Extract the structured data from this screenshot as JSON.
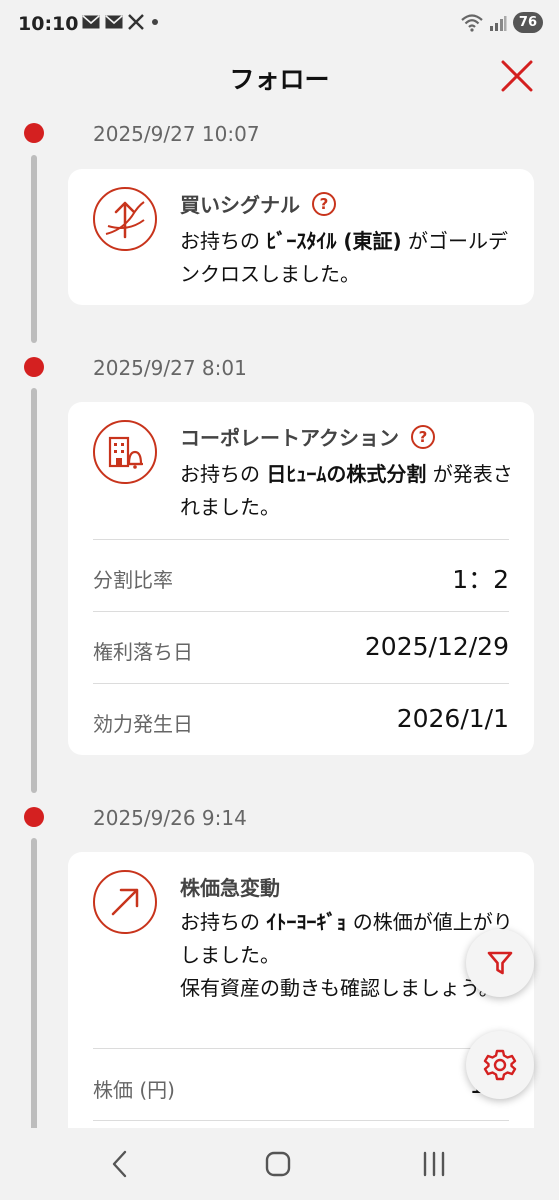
{
  "status_bar": {
    "time": "10:10",
    "battery": "76"
  },
  "header": {
    "title": "フォロー"
  },
  "colors": {
    "accent": "#d42020",
    "icon_stroke": "#c8341c",
    "background": "#f2f2f2"
  },
  "timeline": [
    {
      "date": "2025/9/27 10:07",
      "type": "買いシグナル",
      "icon": "golden-cross-icon",
      "msg_pre": "お持ちの ",
      "msg_bold": "ﾋﾞｰｽﾀｲﾙ (東証)",
      "msg_post": " がゴールデンクロスしました。"
    },
    {
      "date": "2025/9/27 8:01",
      "type": "コーポレートアクション",
      "icon": "building-bell-icon",
      "msg_pre": "お持ちの ",
      "msg_bold": "日ﾋｭｰﾑの株式分割",
      "msg_post": " が発表されました。",
      "rows": [
        {
          "label": "分割比率",
          "value": "1：2"
        },
        {
          "label": "権利落ち日",
          "value": "2025/12/29"
        },
        {
          "label": "効力発生日",
          "value": "2026/1/1"
        }
      ]
    },
    {
      "date": "2025/9/26 9:14",
      "type": "株価急変動",
      "icon": "arrow-up-right-icon",
      "msg_pre": "お持ちの ",
      "msg_bold": "ｲﾄｰﾖｰｷﾞｮ",
      "msg_post": " の株価が値上がりしました。",
      "msg_line2": "保有資産の動きも確認しましょう。",
      "rows": [
        {
          "label": "株価 (円)",
          "value": "1,5"
        }
      ]
    }
  ]
}
